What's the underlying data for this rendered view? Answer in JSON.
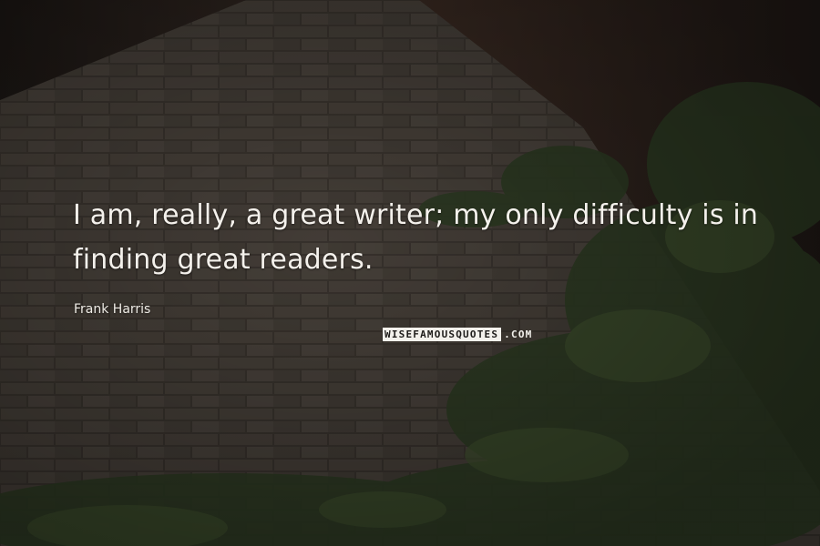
{
  "quote": {
    "text": "I am, really, a great writer; my only difficulty is in finding great readers."
  },
  "author": {
    "name": "Frank Harris"
  },
  "watermark": {
    "part_a": "WISEFAMOUSQUOTES",
    "part_b": ".COM"
  },
  "colors": {
    "text": "#f4f1ec",
    "background": "#2f2a26",
    "ivy": "#2c3a22"
  }
}
